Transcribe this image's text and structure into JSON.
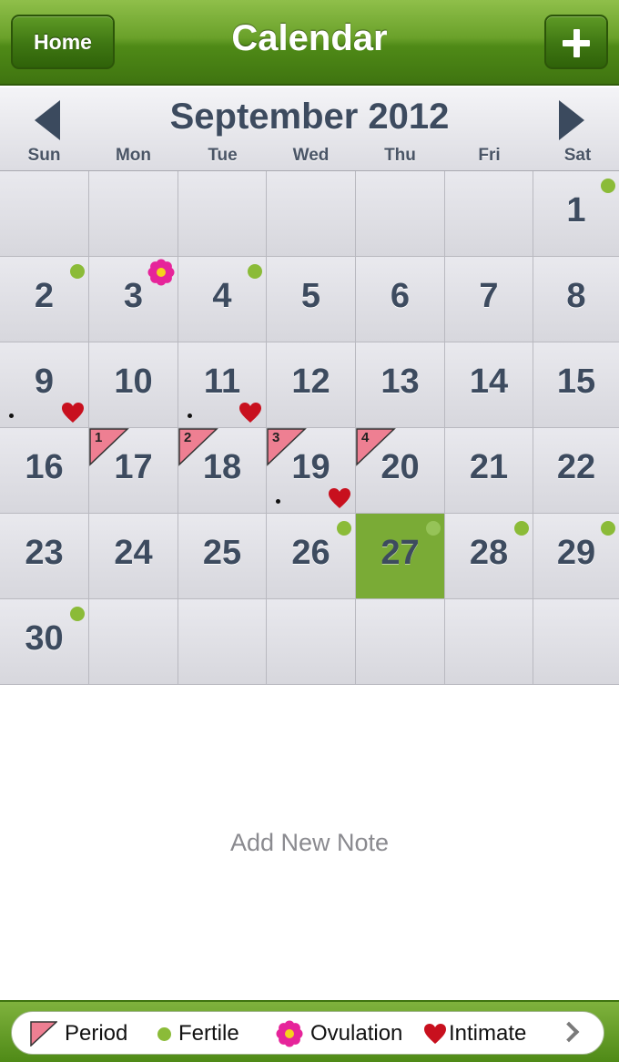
{
  "header": {
    "title": "Calendar",
    "home_label": "Home",
    "add_label": "+"
  },
  "month": {
    "title": "September 2012",
    "weekdays": [
      "Sun",
      "Mon",
      "Tue",
      "Wed",
      "Thu",
      "Fri",
      "Sat"
    ]
  },
  "days": [
    {
      "day": "1",
      "fertile": true
    },
    {
      "day": "2",
      "fertile": true
    },
    {
      "day": "3",
      "ovulation": true
    },
    {
      "day": "4",
      "fertile": true
    },
    {
      "day": "5"
    },
    {
      "day": "6"
    },
    {
      "day": "7"
    },
    {
      "day": "8"
    },
    {
      "day": "9",
      "note": true,
      "intimate": true
    },
    {
      "day": "10"
    },
    {
      "day": "11",
      "note": true,
      "intimate": true
    },
    {
      "day": "12"
    },
    {
      "day": "13"
    },
    {
      "day": "14"
    },
    {
      "day": "15"
    },
    {
      "day": "16"
    },
    {
      "day": "17",
      "period": "1"
    },
    {
      "day": "18",
      "period": "2"
    },
    {
      "day": "19",
      "period": "3",
      "note": true,
      "intimate": true
    },
    {
      "day": "20",
      "period": "4"
    },
    {
      "day": "21"
    },
    {
      "day": "22"
    },
    {
      "day": "23"
    },
    {
      "day": "24"
    },
    {
      "day": "25"
    },
    {
      "day": "26",
      "fertile": true
    },
    {
      "day": "27",
      "fertile": true,
      "today": true
    },
    {
      "day": "28",
      "fertile": true
    },
    {
      "day": "29",
      "fertile": true
    },
    {
      "day": "30",
      "fertile": true
    }
  ],
  "first_weekday_index": 6,
  "note": {
    "add_label": "Add New Note"
  },
  "legend": {
    "period": "Period",
    "fertile": "Fertile",
    "ovulation": "Ovulation",
    "intimate": "Intimate"
  },
  "colors": {
    "header_green": "#4f8a17",
    "today_green": "#7aab36",
    "fertile_dot": "#8bbb38",
    "period_pink": "#ee7f92",
    "ovulation_pink": "#e6249a",
    "intimate_red": "#c8101e",
    "date_text": "#3d4b5f"
  },
  "icons": {
    "prev": "triangle-left-icon",
    "next": "triangle-right-icon",
    "period": "pink-triangle-flag-icon",
    "fertile": "green-dot-icon",
    "ovulation": "flower-icon",
    "intimate": "heart-icon",
    "legend_more": "chevron-right-icon"
  }
}
